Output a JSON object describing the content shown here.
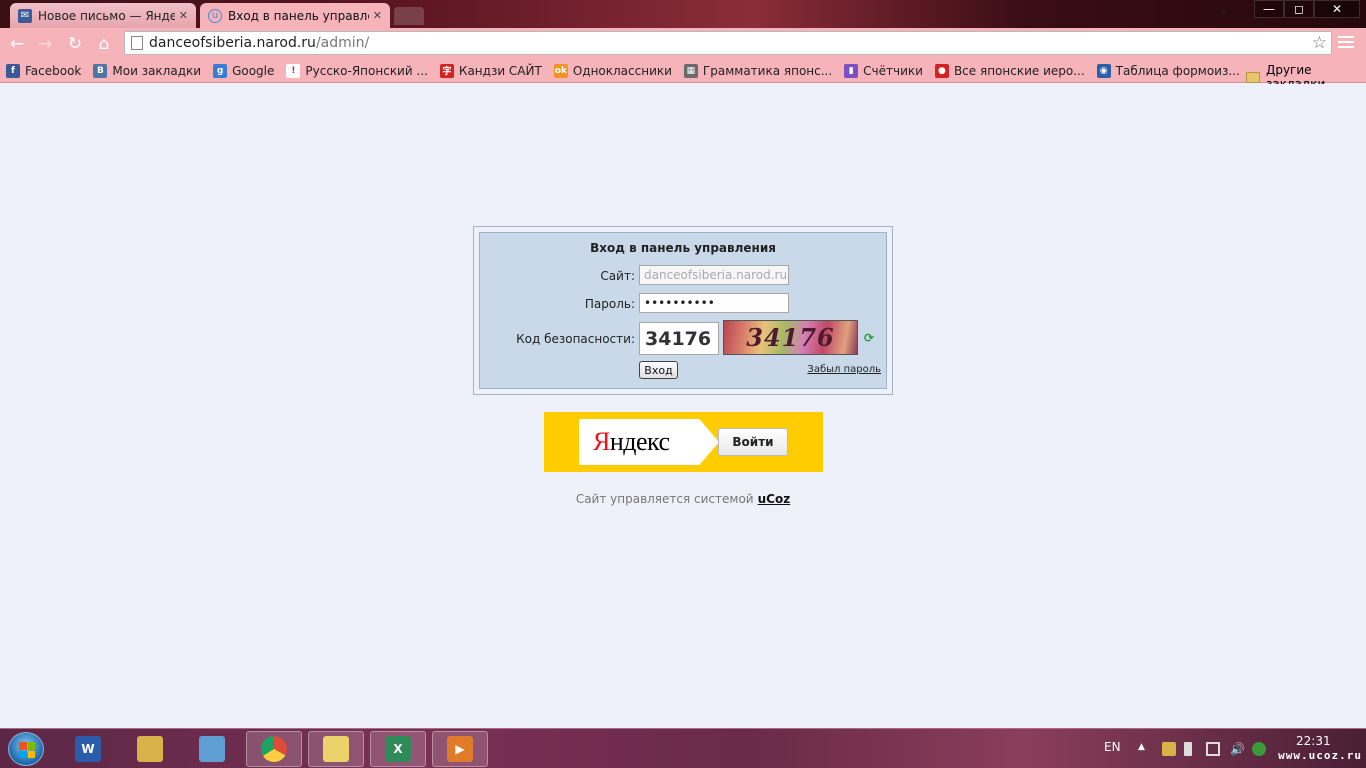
{
  "browser": {
    "tabs": [
      {
        "label": "Новое письмо — Яндекс",
        "icon": "mail-icon",
        "active": false
      },
      {
        "label": "Вход в панель управлени",
        "icon": "ucoz-icon",
        "active": true
      }
    ],
    "window_controls": {
      "minimize": "—",
      "maximize": "◻",
      "close": "✕"
    },
    "nav": {
      "back": "←",
      "forward": "→",
      "reload": "↻",
      "home": "⌂"
    },
    "address": {
      "host": "danceofsiberia.narod.ru",
      "path": "/admin/"
    },
    "bookmarks": [
      {
        "label": "Facebook",
        "icon": "facebook-icon",
        "color": "#3b5998",
        "glyph": "f"
      },
      {
        "label": "Мои закладки",
        "icon": "vk-icon",
        "color": "#4c75a3",
        "glyph": "В"
      },
      {
        "label": "Google",
        "icon": "google-icon",
        "color": "#3a7bd5",
        "glyph": "g"
      },
      {
        "label": "Русско-Японский ...",
        "icon": "exclamation-icon",
        "color": "#ffffff",
        "glyph": "!"
      },
      {
        "label": "Кандзи САЙТ",
        "icon": "kanji-icon",
        "color": "#d42121",
        "glyph": "字"
      },
      {
        "label": "Одноклассники",
        "icon": "odnoklassniki-icon",
        "color": "#f29222",
        "glyph": "ok"
      },
      {
        "label": "Грамматика японс...",
        "icon": "grammar-icon",
        "color": "#6a6a6a",
        "glyph": "▦"
      },
      {
        "label": "Счётчики",
        "icon": "counters-icon",
        "color": "#7d4fc4",
        "glyph": "▮"
      },
      {
        "label": "Все японские иеро...",
        "icon": "japanese-red-icon",
        "color": "#d42121",
        "glyph": "●"
      },
      {
        "label": "Таблица формоиз...",
        "icon": "globe-icon",
        "color": "#2b5fa8",
        "glyph": "◉"
      }
    ],
    "bookmarks_more": "»",
    "other_bookmarks": "Другие закладки"
  },
  "login": {
    "title": "Вход в панель управления",
    "site_label": "Сайт:",
    "site_value": "danceofsiberia.narod.ru",
    "password_label": "Пароль:",
    "password_value": "••••••••••",
    "code_label": "Код безопасности:",
    "code_value": "34176",
    "captcha_text": "34176",
    "submit": "Вход",
    "forgot": "Забыл пароль"
  },
  "yandex": {
    "logo_first": "Я",
    "logo_rest": "ндекс",
    "button": "Войти",
    "color": "#ffcc00"
  },
  "footer": {
    "text": "Сайт управляется системой",
    "link": "uCoz"
  },
  "taskbar": {
    "apps": [
      {
        "name": "word",
        "icon": "word-icon",
        "color": "#2a5caa",
        "glyph": "W",
        "open": false
      },
      {
        "name": "explorer",
        "icon": "folder-icon",
        "color": "#d9b24a",
        "glyph": "",
        "open": false
      },
      {
        "name": "notes",
        "icon": "notepad-icon",
        "color": "#5f9fd4",
        "glyph": "",
        "open": false
      },
      {
        "name": "chrome",
        "icon": "chrome-icon",
        "color": "#dd4b39",
        "glyph": "",
        "open": true
      },
      {
        "name": "sticky",
        "icon": "sticky-notes-icon",
        "color": "#e9d36a",
        "glyph": "",
        "open": true
      },
      {
        "name": "excel",
        "icon": "excel-icon",
        "color": "#2e8b57",
        "glyph": "X",
        "open": true
      },
      {
        "name": "media",
        "icon": "media-player-icon",
        "color": "#e07b2a",
        "glyph": "▶",
        "open": true
      }
    ],
    "language": "EN",
    "time": "22:31",
    "watermark": "www.ucoz.ru"
  }
}
